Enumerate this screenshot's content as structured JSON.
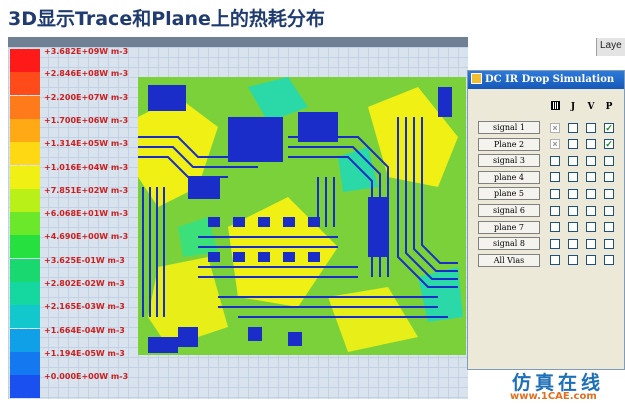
{
  "slide": {
    "title": "3D显示Trace和Plane上的热耗分布"
  },
  "legend": {
    "items": [
      {
        "label": "+3.682E+09W m-3",
        "color": "#ff1a1a"
      },
      {
        "label": "+2.846E+08W m-3",
        "color": "#ff4a1a"
      },
      {
        "label": "+2.200E+07W m-3",
        "color": "#ff7a1a"
      },
      {
        "label": "+1.700E+06W m-3",
        "color": "#ffaa14"
      },
      {
        "label": "+1.314E+05W m-3",
        "color": "#ffd814"
      },
      {
        "label": "+1.016E+04W m-3",
        "color": "#f0f014"
      },
      {
        "label": "+7.851E+02W m-3",
        "color": "#b8f018"
      },
      {
        "label": "+6.068E+01W m-3",
        "color": "#6ce82a"
      },
      {
        "label": "+4.690E+00W m-3",
        "color": "#26e040"
      },
      {
        "label": "+3.625E-01W m-3",
        "color": "#1ad870"
      },
      {
        "label": "+2.802E-02W m-3",
        "color": "#14d8a0"
      },
      {
        "label": "+2.165E-03W m-3",
        "color": "#12c8cc"
      },
      {
        "label": "+1.664E-04W m-3",
        "color": "#10a0e8"
      },
      {
        "label": "+1.194E-05W m-3",
        "color": "#1478f0"
      },
      {
        "label": "+0.000E+00W m-3",
        "color": "#1a50f0"
      }
    ]
  },
  "side_tab": {
    "label": "Laye"
  },
  "dialog": {
    "title": "DC IR Drop Simulation",
    "columns": [
      "J",
      "V",
      "P"
    ],
    "rows": [
      {
        "label": "signal 1",
        "state": [
          "x",
          "",
          "",
          "v"
        ]
      },
      {
        "label": "Plane 2",
        "state": [
          "x",
          "",
          "",
          "v"
        ]
      },
      {
        "label": "signal 3",
        "state": [
          "",
          "",
          "",
          ""
        ]
      },
      {
        "label": "plane 4",
        "state": [
          "",
          "",
          "",
          ""
        ]
      },
      {
        "label": "plane 5",
        "state": [
          "",
          "",
          "",
          ""
        ]
      },
      {
        "label": "signal 6",
        "state": [
          "",
          "",
          "",
          ""
        ]
      },
      {
        "label": "plane 7",
        "state": [
          "",
          "",
          "",
          ""
        ]
      },
      {
        "label": "signal 8",
        "state": [
          "",
          "",
          "",
          ""
        ]
      },
      {
        "label": "All Vias",
        "state": [
          "",
          "",
          "",
          ""
        ]
      }
    ]
  },
  "watermark": {
    "text": "仿真在线",
    "url": "www.1CAE.com"
  },
  "colors": {
    "pcb_green": "#7bd13a",
    "trace_blue": "#1a2dc8",
    "hot_yellow": "#f0f014",
    "dialog_title": "#1658b8"
  }
}
